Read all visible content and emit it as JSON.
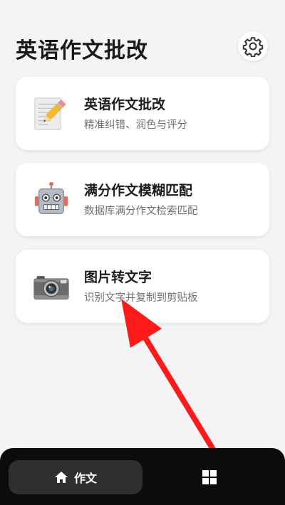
{
  "header": {
    "title": "英语作文批改",
    "settings_icon": "gear-icon"
  },
  "cards": [
    {
      "title": "英语作文批改",
      "subtitle": "精准纠错、润色与评分",
      "icon": "notepad-pencil-icon"
    },
    {
      "title": "满分作文模糊匹配",
      "subtitle": "数据库满分作文检索匹配",
      "icon": "robot-icon"
    },
    {
      "title": "图片转文字",
      "subtitle": "识别文字并复制到剪贴板",
      "icon": "camera-icon"
    }
  ],
  "bottom_nav": {
    "items": [
      {
        "label": "作文",
        "icon": "home-icon",
        "active": true
      },
      {
        "label": "",
        "icon": "grid-icon",
        "active": false
      }
    ]
  },
  "colors": {
    "background": "#f4f4f6",
    "card": "#ffffff",
    "nav_bar": "#0c0c0c",
    "nav_active": "#2f2f2f",
    "annotation_arrow": "#ff1a1a"
  }
}
